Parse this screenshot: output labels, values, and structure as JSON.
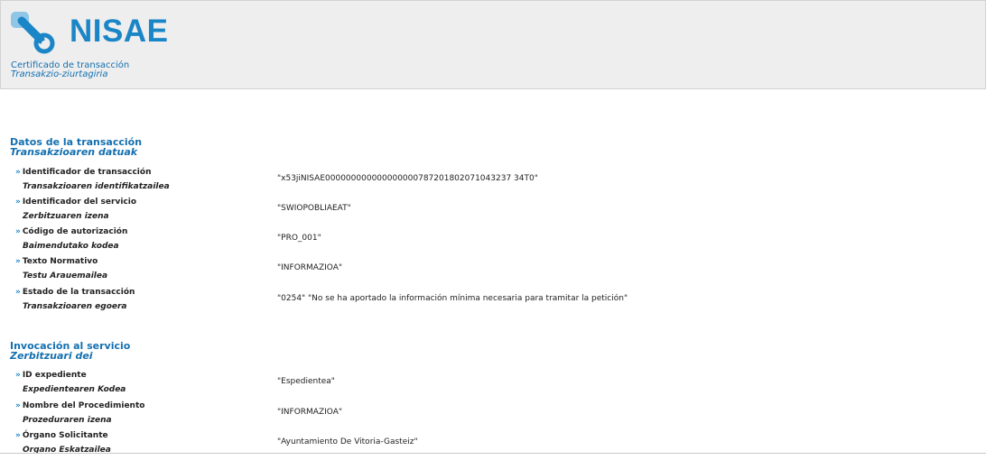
{
  "header": {
    "brand": "NISAE",
    "subtitle_es": "Certificado de transacción",
    "subtitle_eu": "Transakzio-ziurtagiria",
    "logo_icon": "link-chain-icon",
    "brand_color": "#1b86c7"
  },
  "sections": [
    {
      "title_es": "Datos de la transacción",
      "title_eu": "Transakzioaren datuak",
      "rows": [
        {
          "label_es": "Identificador de transacción",
          "label_eu": "Transakzioaren identifikatzailea",
          "value": "\"x53jiNISAE000000000000000000787201802071043237 34T0\""
        },
        {
          "label_es": "Identificador del servicio",
          "label_eu": "Zerbitzuaren izena",
          "value": "\"SWIOPOBLIAEAT\""
        },
        {
          "label_es": "Código de autorización",
          "label_eu": "Baimendutako kodea",
          "value": "\"PRO_001\""
        },
        {
          "label_es": "Texto Normativo",
          "label_eu": "Testu Arauemailea",
          "value": "\"INFORMAZIOA\""
        },
        {
          "label_es": "Estado de la transacción",
          "label_eu": "Transakzioaren egoera",
          "value": "\"0254\" \"No se ha aportado la información mínima necesaria para tramitar la petición\""
        }
      ]
    },
    {
      "title_es": "Invocación al servicio",
      "title_eu": "Zerbitzuari dei",
      "rows": [
        {
          "label_es": "ID expediente",
          "label_eu": "Expedientearen Kodea",
          "value": "\"Espedientea\""
        },
        {
          "label_es": "Nombre del Procedimiento",
          "label_eu": "Prozeduraren izena",
          "value": "\"INFORMAZIOA\""
        },
        {
          "label_es": "Órgano Solicitante",
          "label_eu": "Organo Eskatzailea",
          "value": "\"Ayuntamiento De Vitoria-Gasteiz\""
        }
      ]
    }
  ]
}
